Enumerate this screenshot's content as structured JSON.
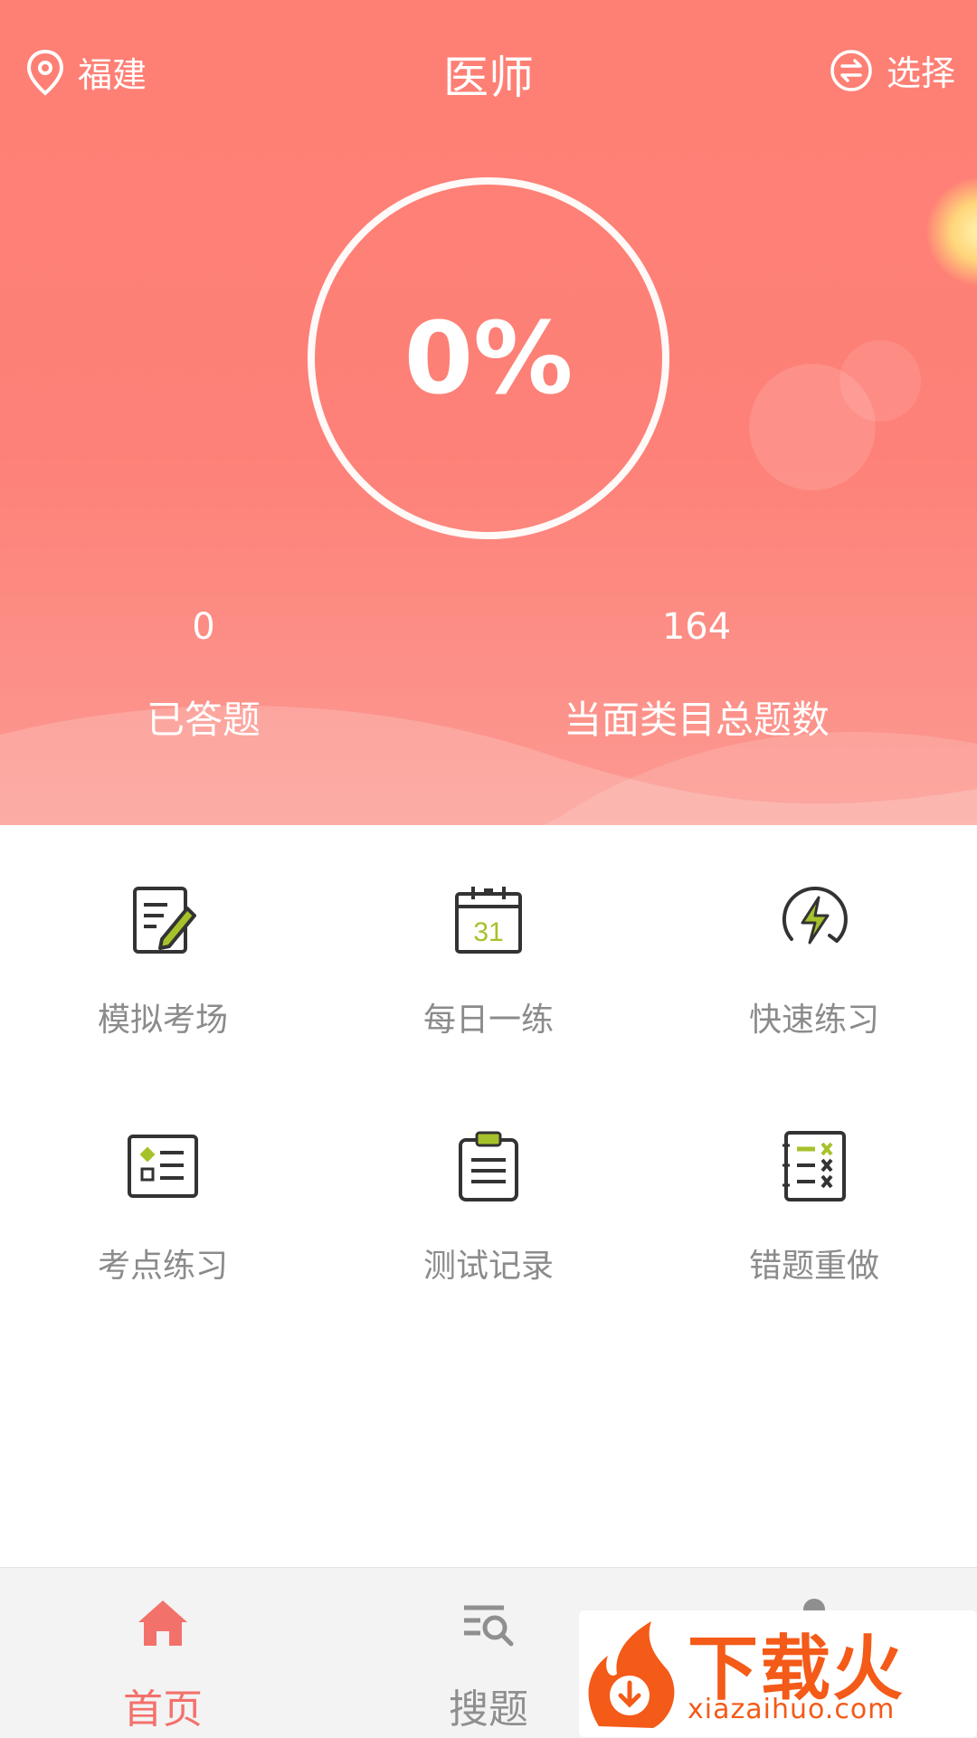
{
  "header": {
    "location": "福建",
    "title": "医师",
    "select_label": "选择"
  },
  "progress": {
    "percent_label": "0%",
    "value": 0
  },
  "stats": {
    "answered": {
      "value": "0",
      "label": "已答题"
    },
    "total": {
      "value": "164",
      "label": "当面类目总题数"
    }
  },
  "features": [
    {
      "label": "模拟考场",
      "icon": "edit-paper-icon"
    },
    {
      "label": "每日一练",
      "icon": "calendar-icon"
    },
    {
      "label": "快速练习",
      "icon": "lightning-icon"
    },
    {
      "label": "考点练习",
      "icon": "list-card-icon"
    },
    {
      "label": "测试记录",
      "icon": "clipboard-icon"
    },
    {
      "label": "错题重做",
      "icon": "wrong-questions-icon"
    }
  ],
  "calendar_day": "31",
  "tabbar": {
    "items": [
      {
        "label": "首页",
        "icon": "home-icon",
        "active": true
      },
      {
        "label": "搜题",
        "icon": "search-list-icon",
        "active": false
      },
      {
        "label": "",
        "icon": "profile-icon",
        "active": false
      }
    ]
  },
  "watermark": {
    "main": "下载火",
    "sub": "xiazaihuo.com"
  },
  "colors": {
    "hero": "#fd8178",
    "accent": "#f3716b",
    "icon_green": "#a6c22a",
    "icon_dark": "#333333"
  }
}
